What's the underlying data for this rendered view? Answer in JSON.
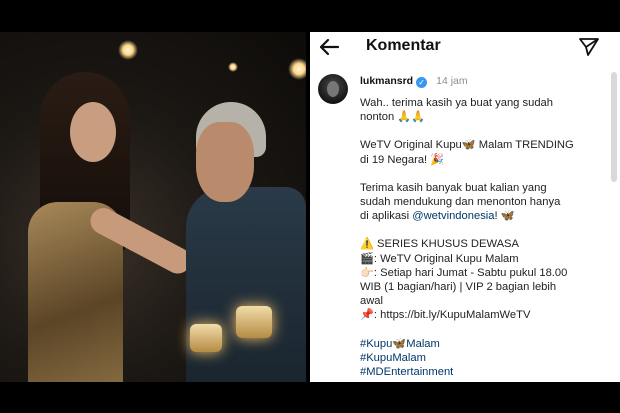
{
  "header": {
    "title": "Komentar"
  },
  "comment": {
    "username": "lukmansrd",
    "time": "14 jam",
    "lines": [
      "Wah.. terima kasih ya buat yang sudah",
      "nonton 🙏🙏"
    ],
    "trending_lines": [
      "WeTV Original Kupu🦋 Malam TRENDING",
      "di 19 Negara! 🎉"
    ],
    "thanks_lines": [
      "Terima kasih banyak buat kalian yang",
      "sudah mendukung dan menonton hanya"
    ],
    "thanks_prefix": "di aplikasi ",
    "mention": "@wetvindonesia",
    "thanks_suffix": "! 🦋",
    "series_lines": [
      "⚠️ SERIES KHUSUS DEWASA",
      "🎬: WeTV Original Kupu Malam",
      "👉🏻: Setiap hari Jumat - Sabtu pukul 18.00",
      "WIB (1 bagian/hari) | VIP 2 bagian lebih",
      "awal",
      "📌: https://bit.ly/KupuMalamWeTV"
    ],
    "hashtags": [
      "#Kupu🦋Malam",
      "#KupuMalam",
      "#MDEntertainment"
    ]
  },
  "colors": {
    "link": "#00376b",
    "verified": "#3897f0"
  }
}
